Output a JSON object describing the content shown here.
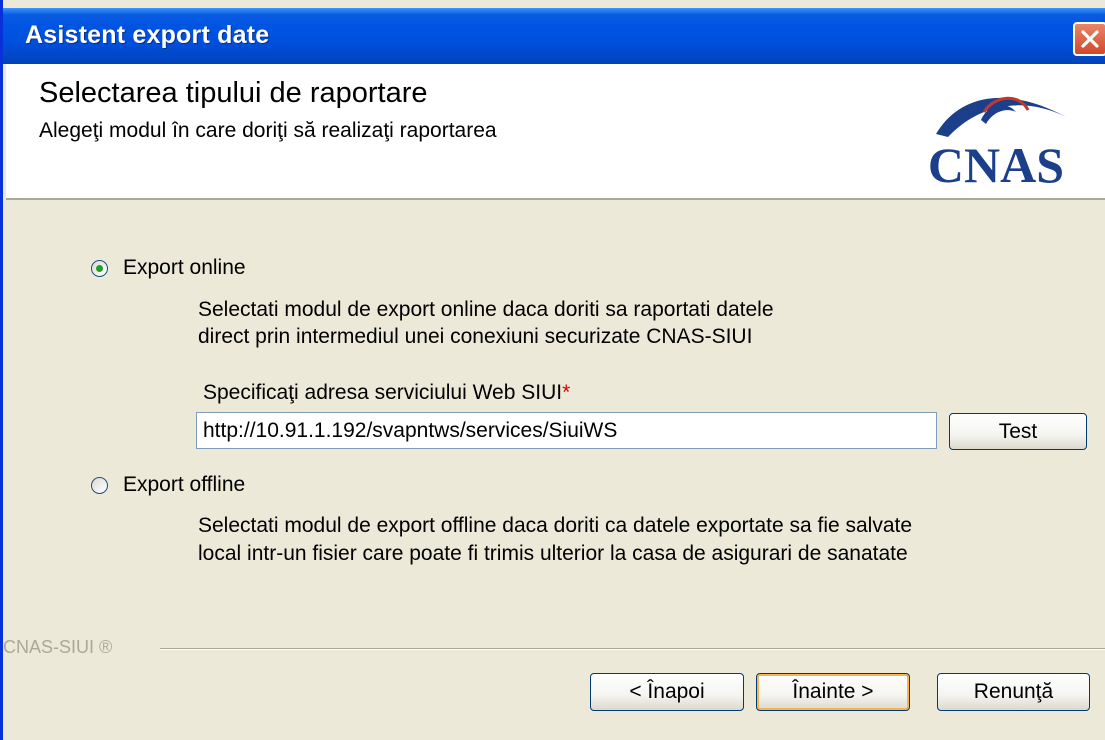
{
  "window": {
    "title": "Asistent export date"
  },
  "header": {
    "title": "Selectarea tipului de raportare",
    "subtitle": "Alegeţi modul în care doriţi să realizaţi raportarea",
    "logo_text": "CNAS"
  },
  "options": {
    "online": {
      "label": "Export online",
      "selected": true,
      "desc_line1": "Selectati modul de export online daca doriti sa raportati datele",
      "desc_line2": "direct prin intermediul unei conexiuni securizate CNAS-SIUI"
    },
    "service": {
      "label": "Specificaţi adresa serviciului Web SIUI",
      "required_mark": "*",
      "url_value": "http://10.91.1.192/svapntws/services/SiuiWS",
      "test_button": "Test"
    },
    "offline": {
      "label": "Export offline",
      "selected": false,
      "desc_line1": "Selectati modul de export offline daca doriti ca datele exportate sa fie salvate",
      "desc_line2": "local intr-un fisier care poate fi trimis ulterior la casa de asigurari de sanatate"
    }
  },
  "footer": {
    "brand": "CNAS-SIUI ®",
    "back_button": "< Înapoi",
    "next_button": "Înainte >",
    "cancel_button": "Renunţă"
  },
  "colors": {
    "titlebar": "#0054e3",
    "close_button": "#d1482a",
    "logo": "#1c3f8c",
    "radio_dot": "#21a121",
    "required": "#e00000"
  },
  "icons": {
    "close": "close-icon",
    "logo": "cnas-logo"
  }
}
